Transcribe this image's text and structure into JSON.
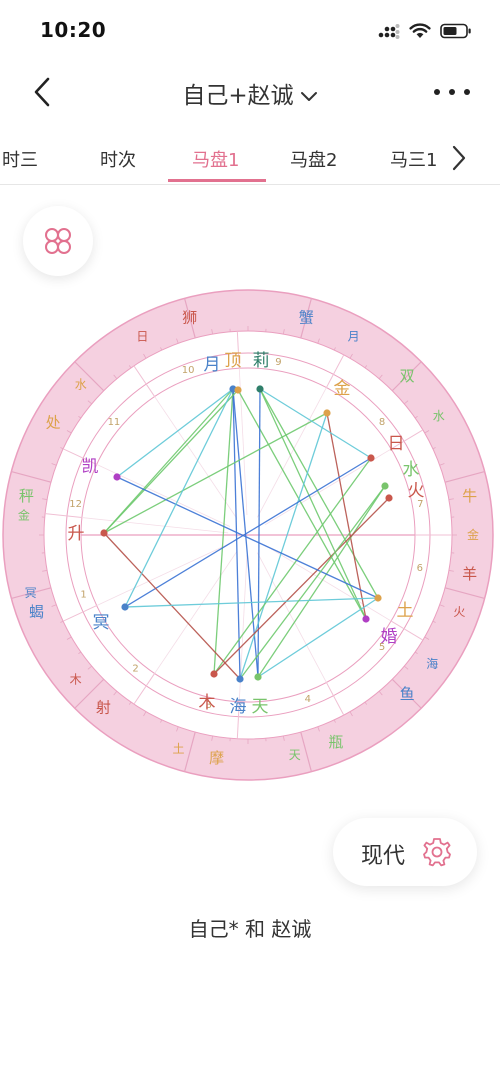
{
  "status_bar": {
    "time": "10:20"
  },
  "nav": {
    "title": "自己+赵诚"
  },
  "tabs": [
    {
      "label": "时三",
      "active": false
    },
    {
      "label": "时次",
      "active": false
    },
    {
      "label": "马盘1",
      "active": true
    },
    {
      "label": "马盘2",
      "active": false
    },
    {
      "label": "马三1",
      "active": false
    }
  ],
  "colors": {
    "accent": "#e2718f",
    "ring": "#f5d0e0",
    "fire": "#c9574c",
    "earth": "#dda24b",
    "air": "#79c46c",
    "water": "#4a82c9",
    "aspect_blue": "#3a73d4",
    "aspect_green": "#6ec96e",
    "aspect_red": "#b5524a",
    "aspect_cyan": "#5fc7d6"
  },
  "chart": {
    "signs": [
      {
        "name": "羊",
        "ruler": "火"
      },
      {
        "name": "牛",
        "ruler": "金"
      },
      {
        "name": "双",
        "ruler": "水"
      },
      {
        "name": "蟹",
        "ruler": "月"
      },
      {
        "name": "狮",
        "ruler": "日"
      },
      {
        "name": "处",
        "ruler": "水"
      },
      {
        "name": "秤",
        "ruler": "金"
      },
      {
        "name": "蝎",
        "ruler": "冥"
      },
      {
        "name": "射",
        "ruler": "木"
      },
      {
        "name": "摩",
        "ruler": "土"
      },
      {
        "name": "瓶",
        "ruler": "天"
      },
      {
        "name": "鱼",
        "ruler": "海"
      }
    ],
    "houses": [
      "1",
      "2",
      "3",
      "4",
      "5",
      "6",
      "7",
      "8",
      "9",
      "10",
      "11",
      "12"
    ],
    "planets": [
      {
        "label": "月",
        "color": "#4a82c9"
      },
      {
        "label": "顶",
        "color": "#dda24b"
      },
      {
        "label": "莉",
        "color": "#2f7f6a"
      },
      {
        "label": "金",
        "color": "#dda24b"
      },
      {
        "label": "日",
        "color": "#c9574c"
      },
      {
        "label": "水",
        "color": "#79c46c"
      },
      {
        "label": "火",
        "color": "#c9574c"
      },
      {
        "label": "凯",
        "color": "#b03fc4"
      },
      {
        "label": "升",
        "color": "#c9574c"
      },
      {
        "label": "冥",
        "color": "#4a82c9"
      },
      {
        "label": "土",
        "color": "#dda24b"
      },
      {
        "label": "婚",
        "color": "#b03fc4"
      },
      {
        "label": "木",
        "color": "#c9574c"
      },
      {
        "label": "海",
        "color": "#4a82c9"
      },
      {
        "label": "天",
        "color": "#79c46c"
      }
    ]
  },
  "mode": {
    "label": "现代"
  },
  "caption": "自己* 和 赵诚"
}
